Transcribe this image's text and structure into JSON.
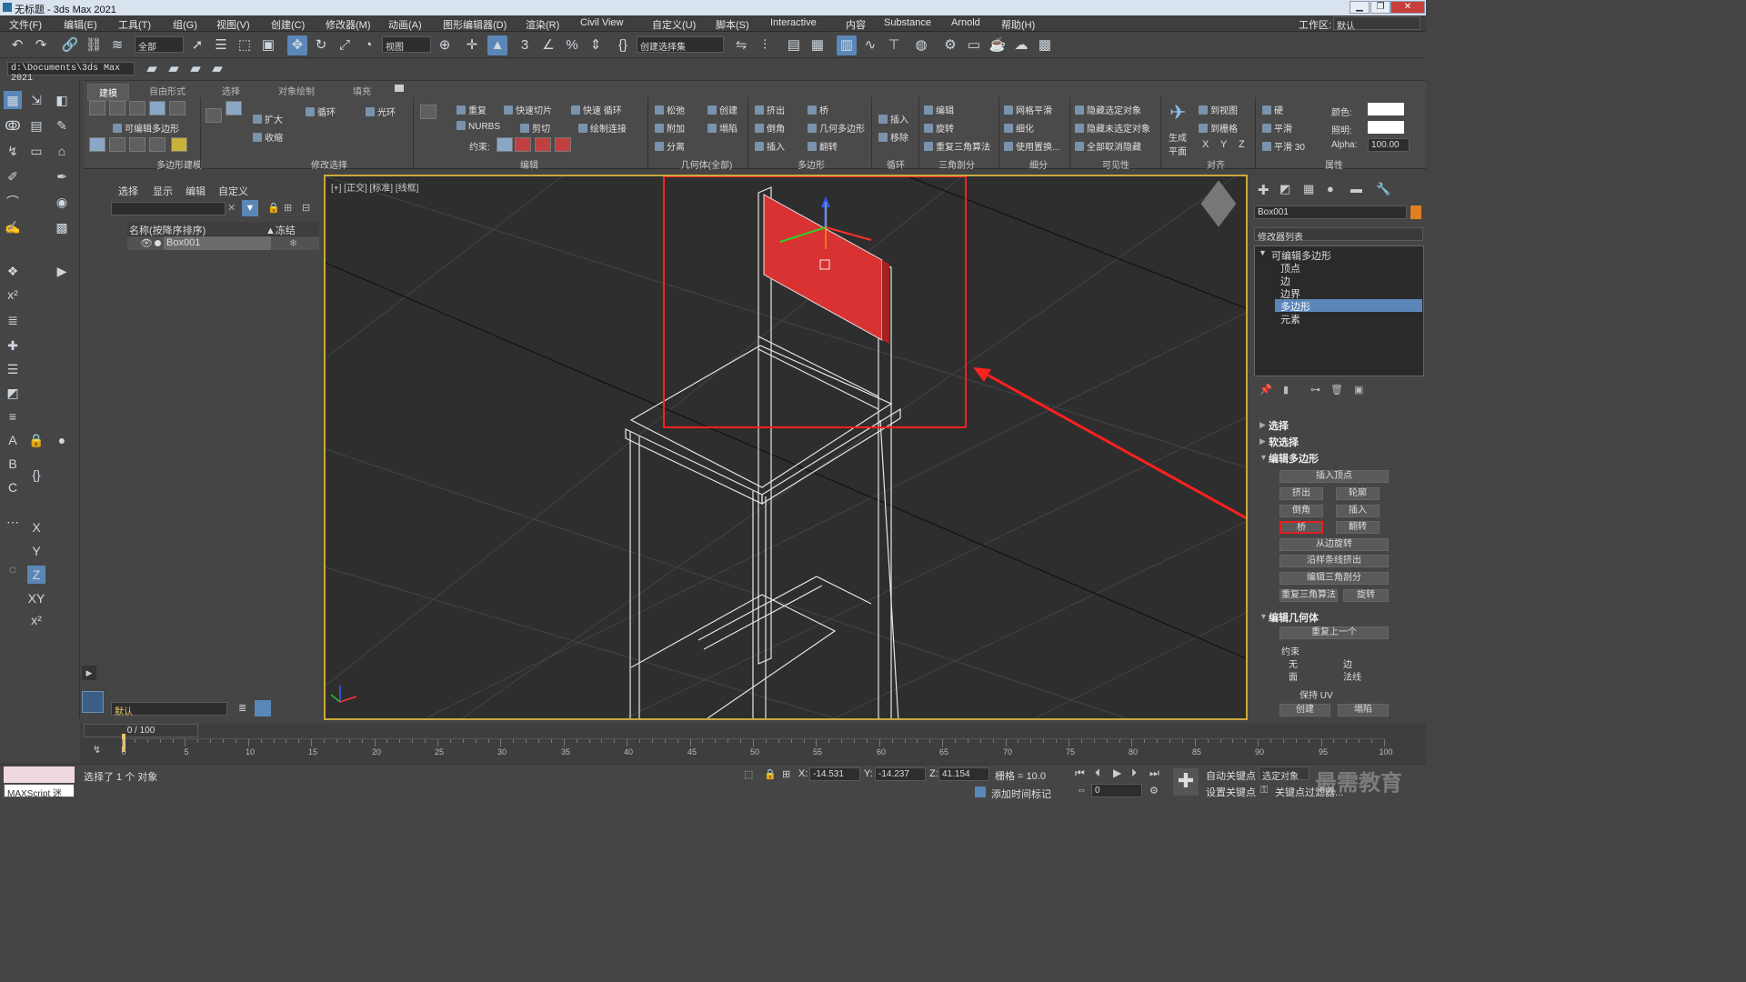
{
  "title": "无标题 - 3ds Max 2021",
  "menu": [
    "文件(F)",
    "编辑(E)",
    "工具(T)",
    "组(G)",
    "视图(V)",
    "创建(C)",
    "修改器(M)",
    "动画(A)",
    "图形编辑器(D)",
    "渲染(R)",
    "Civil View",
    "自定义(U)",
    "脚本(S)",
    "Interactive",
    "内容",
    "Substance",
    "Arnold",
    "帮助(H)"
  ],
  "workspace_label": "工作区:",
  "workspace_value": "默认",
  "toolbar": {
    "filter": "全部",
    "ref_coord": "视图",
    "named_sel": "创建选择集"
  },
  "path": "d:\\Documents\\3ds Max 2021",
  "ribbon": {
    "tabs": [
      "建模",
      "自由形式",
      "选择",
      "对象绘制",
      "填充"
    ],
    "subobj_label": "可编辑多边形",
    "group_labels": [
      "多边形建模",
      "修改选择",
      "编辑",
      "几何体(全部)",
      "多边形",
      "循环",
      "三角剖分",
      "细分",
      "可见性",
      "对齐",
      "属性"
    ],
    "modsel": [
      "扩大",
      "收缩",
      "循环",
      "光环"
    ],
    "edit": [
      "重复",
      "快速切片",
      "快速 循环",
      "NURBS",
      "剪切",
      "绘制连接"
    ],
    "constraint": "约束:",
    "geometry": [
      "松弛",
      "创建",
      "附加",
      "塌陷",
      "分离"
    ],
    "polygons": [
      "挤出",
      "桥",
      "倒角",
      "几何多边形",
      "插入",
      "翻转"
    ],
    "loops": [
      "插入",
      "移除"
    ],
    "tri": [
      "编辑",
      "旋转",
      "重复三角算法"
    ],
    "subdiv": [
      "网格平滑",
      "细化",
      "使用置换..."
    ],
    "visibility": [
      "隐藏选定对象",
      "隐藏未选定对象",
      "全部取消隐藏"
    ],
    "align": [
      "生成平面",
      "到视图",
      "到栅格",
      "X",
      "Y",
      "Z"
    ],
    "props": [
      "硬",
      "平滑",
      "平滑 30",
      "颜色:",
      "照明:",
      "Alpha:"
    ],
    "alpha_value": "100.00"
  },
  "scene_explorer": {
    "tabs": [
      "选择",
      "显示",
      "编辑",
      "自定义"
    ],
    "col_name": "名称(按降序排序)",
    "col_frozen": "▲冻结",
    "objects": [
      "Box001"
    ],
    "layer": "默认"
  },
  "viewport": {
    "label": "[+] [正交] [标准] [线框]",
    "view_cube": "view-cube"
  },
  "command_panel": {
    "object_name": "Box001",
    "modifier_list": "修改器列表",
    "stack": [
      "可编辑多边形",
      "顶点",
      "边",
      "边界",
      "多边形",
      "元素"
    ],
    "selected_stack": "多边形",
    "rollouts": [
      "选择",
      "软选择",
      "编辑多边形",
      "编辑几何体"
    ],
    "edit_poly_buttons": [
      "插入顶点",
      "挤出",
      "轮廓",
      "倒角",
      "插入",
      "桥",
      "翻转",
      "从边旋转",
      "沿样条线挤出",
      "编辑三角剖分",
      "重复三角算法",
      "旋转"
    ],
    "edit_geom": {
      "repeat": "重复上一个",
      "constraints": "约束",
      "opts": [
        "无",
        "边",
        "面",
        "法线"
      ],
      "keep_uv": "保持 UV",
      "create": "创建",
      "collapse": "塌陷"
    }
  },
  "timeline": {
    "frame": "0 / 100",
    "ticks": [
      "0",
      "5",
      "10",
      "15",
      "20",
      "25",
      "30",
      "35",
      "40",
      "45",
      "50",
      "55",
      "60",
      "65",
      "70",
      "75",
      "80",
      "85",
      "90",
      "95",
      "100"
    ]
  },
  "status": {
    "maxscript": "MAXScript 迷",
    "selected": "选择了 1 个 对象",
    "x_label": "X:",
    "x": "-14.531",
    "y_label": "Y:",
    "y": "-14.237",
    "z_label": "Z:",
    "z": "41.154",
    "grid": "栅格 = 10.0",
    "add_tag": "添加时间标记",
    "auto_key": "自动关键点",
    "sel_obj": "选定对象",
    "set_key": "设置关键点",
    "key_filter": "关键点过滤器...",
    "frame_field": "0",
    "watermark": "最需教育"
  },
  "colors": {
    "accent_red": "#e03030",
    "viewport_border": "#c9a93c",
    "selection_blue": "#5b86b8"
  }
}
